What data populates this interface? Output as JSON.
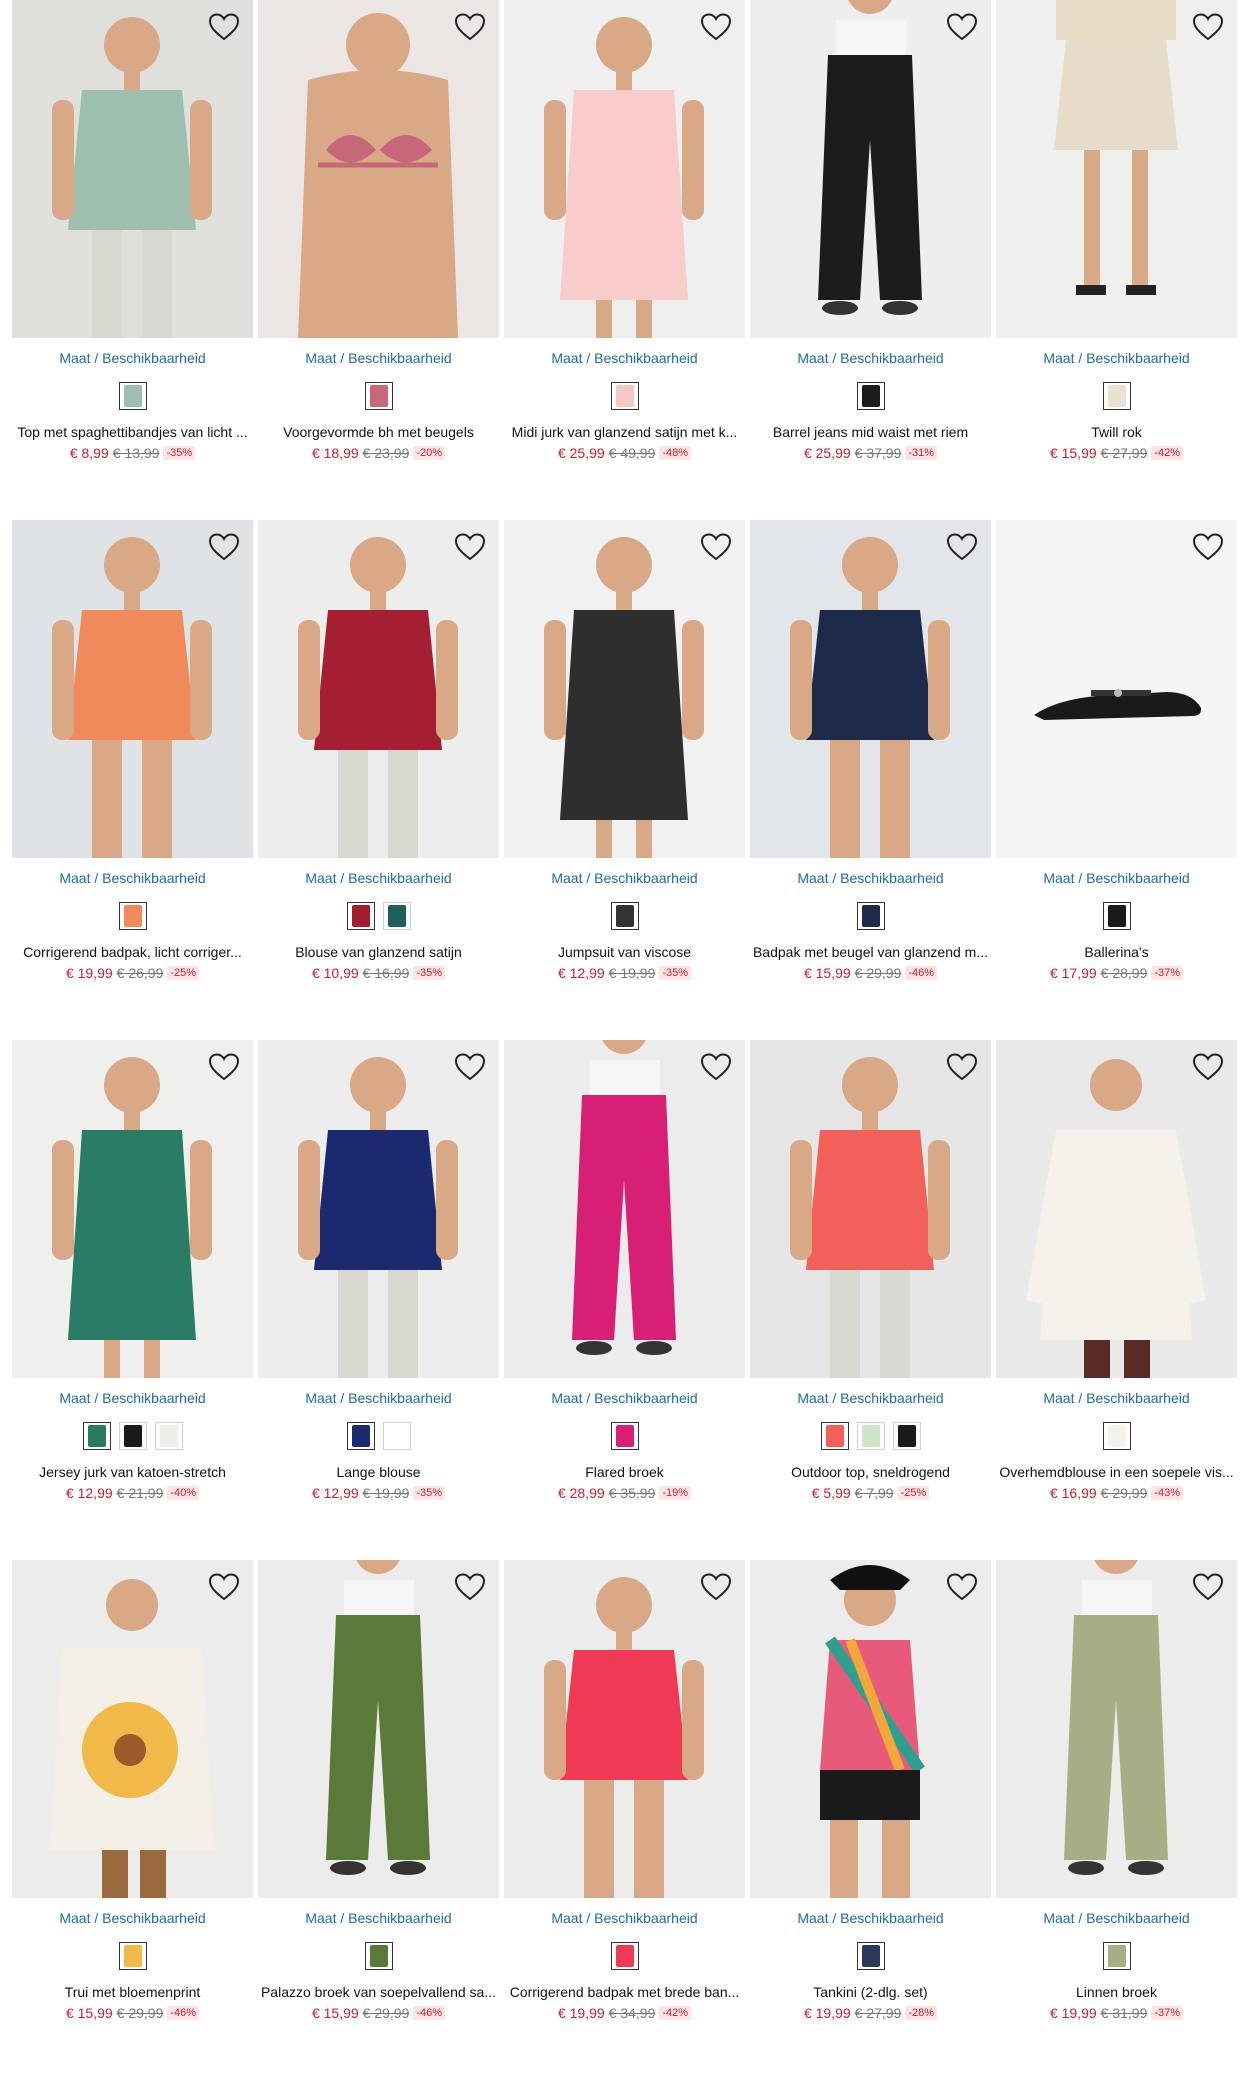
{
  "size_link_label": "Maat / Beschikbaarheid",
  "products": [
    {
      "name": "Top met spaghettibandjes van licht ...",
      "price": "€ 8,99",
      "old_price": "€ 13,99",
      "discount": "-35%",
      "colors": [
        "#9fbfae"
      ],
      "bg": "#dfe0dc",
      "garment": "#9fbfae",
      "icon": "camisole-image"
    },
    {
      "name": "Voorgevormde bh met beugels",
      "price": "€ 18,99",
      "old_price": "€ 23,99",
      "discount": "-20%",
      "colors": [
        "#c6677a"
      ],
      "bg": "#ebe5e3",
      "garment": "#c6677a",
      "icon": "bra-image"
    },
    {
      "name": "Midi jurk van glanzend satijn met k...",
      "price": "€ 25,99",
      "old_price": "€ 49,99",
      "discount": "-48%",
      "colors": [
        "#f5c7c5"
      ],
      "bg": "#efefef",
      "garment": "#f7cccb",
      "icon": "dress-image"
    },
    {
      "name": "Barrel jeans mid waist met riem",
      "price": "€ 25,99",
      "old_price": "€ 37,99",
      "discount": "-31%",
      "colors": [
        "#1c1c1c"
      ],
      "bg": "#eeeeee",
      "garment": "#1c1c1c",
      "icon": "jeans-image"
    },
    {
      "name": "Twill rok",
      "price": "€ 15,99",
      "old_price": "€ 27,99",
      "discount": "-42%",
      "colors": [
        "#eae1d1"
      ],
      "bg": "#efefed",
      "garment": "#e6dcc9",
      "icon": "skirt-image"
    },
    {
      "name": "Corrigerend badpak, licht corriger...",
      "price": "€ 19,99",
      "old_price": "€ 26,99",
      "discount": "-25%",
      "colors": [
        "#f08a5a"
      ],
      "bg": "#dfe3e6",
      "garment": "#f08a5a",
      "icon": "swimsuit-image"
    },
    {
      "name": "Blouse van glanzend satijn",
      "price": "€ 10,99",
      "old_price": "€ 16,99",
      "discount": "-35%",
      "colors": [
        "#a01d2e",
        "#1f5e5d"
      ],
      "bg": "#ededed",
      "garment": "#a31f31",
      "icon": "blouse-image"
    },
    {
      "name": "Jumpsuit van viscose",
      "price": "€ 12,99",
      "old_price": "€ 19,99",
      "discount": "-35%",
      "colors": [
        "#333333"
      ],
      "bg": "#f1f1f1",
      "garment": "#2e2e2e",
      "icon": "jumpsuit-image"
    },
    {
      "name": "Badpak met beugel van glanzend m...",
      "price": "€ 15,99",
      "old_price": "€ 29,99",
      "discount": "-46%",
      "colors": [
        "#1e2a4a"
      ],
      "bg": "#e2e5ea",
      "garment": "#1e2a4a",
      "icon": "swimsuit-image"
    },
    {
      "name": "Ballerina's",
      "price": "€ 17,99",
      "old_price": "€ 28,99",
      "discount": "-37%",
      "colors": [
        "#1a1a1a"
      ],
      "bg": "#f5f5f5",
      "garment": "#1a1a1a",
      "icon": "shoe-image"
    },
    {
      "name": "Jersey jurk van katoen-stretch",
      "price": "€ 12,99",
      "old_price": "€ 21,99",
      "discount": "-40%",
      "colors": [
        "#2a7a62",
        "#1a1a1a",
        "#eeeee6"
      ],
      "bg": "#efefed",
      "garment": "#2b7c64",
      "icon": "dress-image"
    },
    {
      "name": "Lange blouse",
      "price": "€ 12,99",
      "old_price": "€ 19,99",
      "discount": "-35%",
      "colors": [
        "#1b2a6e",
        "#ffffff"
      ],
      "bg": "#ededed",
      "garment": "#1b2a6e",
      "icon": "blouse-image"
    },
    {
      "name": "Flared broek",
      "price": "€ 28,99",
      "old_price": "€ 35,99",
      "discount": "-19%",
      "colors": [
        "#d61f75"
      ],
      "bg": "#ececec",
      "garment": "#d61f75",
      "icon": "trousers-image"
    },
    {
      "name": "Outdoor top, sneldrogend",
      "price": "€ 5,99",
      "old_price": "€ 7,99",
      "discount": "-25%",
      "colors": [
        "#f2605a",
        "#cfe5c8",
        "#1a1a1a"
      ],
      "bg": "#e6e6e6",
      "garment": "#f2605a",
      "icon": "tanktop-image"
    },
    {
      "name": "Overhemdblouse in een soepele vis...",
      "price": "€ 16,99",
      "old_price": "€ 29,99",
      "discount": "-43%",
      "colors": [
        "#f4f1e9"
      ],
      "bg": "#e9e9e9",
      "garment": "#f4f2ea",
      "icon": "shirt-image"
    },
    {
      "name": "Trui met bloemenprint",
      "price": "€ 15,99",
      "old_price": "€ 29,99",
      "discount": "-46%",
      "colors": [
        "#f1b94a"
      ],
      "bg": "#ececea",
      "garment": "#f3efe6",
      "icon": "sweater-image"
    },
    {
      "name": "Palazzo broek van soepelvallend sa...",
      "price": "€ 15,99",
      "old_price": "€ 29,99",
      "discount": "-46%",
      "colors": [
        "#5b7a3a"
      ],
      "bg": "#ececec",
      "garment": "#5b7a3a",
      "icon": "trousers-image"
    },
    {
      "name": "Corrigerend badpak met brede ban...",
      "price": "€ 19,99",
      "old_price": "€ 34,99",
      "discount": "-42%",
      "colors": [
        "#f03a55"
      ],
      "bg": "#ececec",
      "garment": "#f03a55",
      "icon": "swimsuit-image"
    },
    {
      "name": "Tankini (2-dlg. set)",
      "price": "€ 19,99",
      "old_price": "€ 27,99",
      "discount": "-28%",
      "colors": [
        "#2a3a5a"
      ],
      "bg": "#ececec",
      "garment": "#e85a7a",
      "icon": "tankini-image"
    },
    {
      "name": "Linnen broek",
      "price": "€ 19,99",
      "old_price": "€ 31,99",
      "discount": "-37%",
      "colors": [
        "#a8ad86"
      ],
      "bg": "#ececea",
      "garment": "#a8ad86",
      "icon": "trousers-image"
    }
  ]
}
